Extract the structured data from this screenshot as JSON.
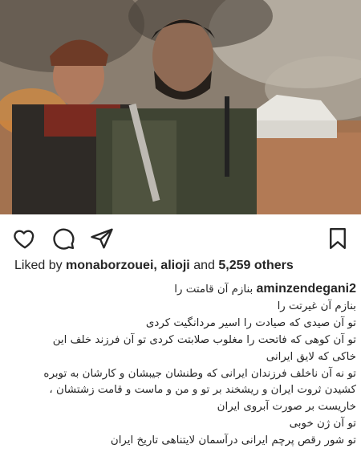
{
  "post": {
    "image_alt": "photo-two-soldiers-battlefield",
    "likes": {
      "prefix": "Liked by",
      "user1": "monaborzouei",
      "sep": ",",
      "user2": "alioji",
      "middle": "and",
      "count": "5,259 others"
    },
    "author": "aminzendegani2",
    "caption_first": "بنازم آن قامتت را",
    "caption_lines": [
      "بنازم آن غیرتت را",
      "تو آن صیدی که صیادت را اسیر مردانگیت کردی",
      "تو آن کوهی که فاتحت را مغلوب صلابتت کردی  تو آن فرزند خلف این",
      "خاکی که لایق ایرانی",
      "تو نه آن ناخلف فرزندان ایرانی که وطنشان جیبشان  و کارشان به توبره",
      "کشیدن ثروت ایران و ریشخند بر تو و من و ماست و قامت زشتشان ،",
      "خاریست بر صورت آبروی ایران",
      "تو آن ژن خوبی",
      "تو شور رقص پرچم ایرانی درآسمان لایتناهی تاریخ ایران"
    ]
  },
  "icons": {
    "like": "heart-icon",
    "comment": "comment-icon",
    "share": "send-icon",
    "save": "bookmark-icon"
  }
}
